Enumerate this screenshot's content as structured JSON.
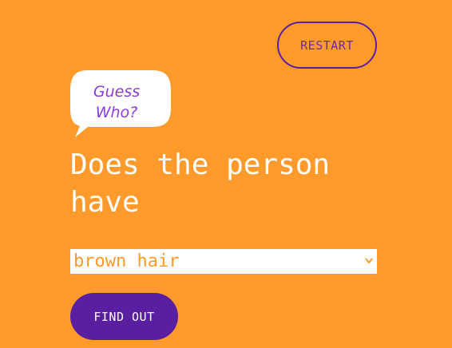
{
  "header": {
    "restart_label": "RESTART"
  },
  "logo": {
    "line1": "Guess",
    "line2": "Who?"
  },
  "question": {
    "text_line1": "Does the person",
    "text_line2": "have"
  },
  "attribute_select": {
    "selected_value": "brown hair",
    "chevron_icon": "chevron-down-icon"
  },
  "actions": {
    "find_out_label": "FIND OUT"
  },
  "colors": {
    "background": "#ff9a2b",
    "accent_purple": "#5a1fa0",
    "logo_text": "#8b3bdc",
    "text_light": "#ffffff"
  }
}
